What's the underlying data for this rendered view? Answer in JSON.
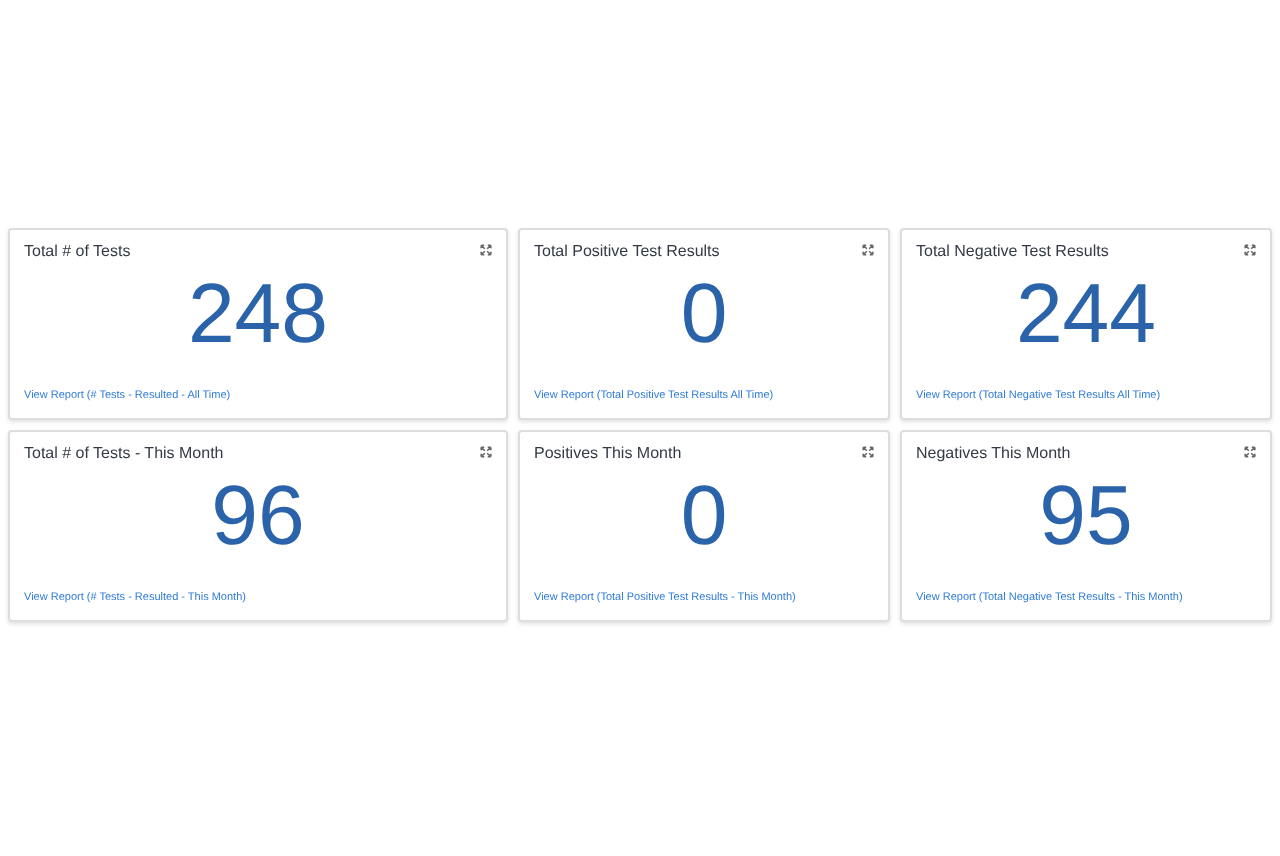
{
  "cards": [
    {
      "title": "Total # of Tests",
      "value": "248",
      "link": "View Report (# Tests - Resulted - All Time)"
    },
    {
      "title": "Total Positive Test Results",
      "value": "0",
      "link": "View Report (Total Positive Test Results All Time)"
    },
    {
      "title": "Total Negative Test Results",
      "value": "244",
      "link": "View Report (Total Negative Test Results All Time)"
    },
    {
      "title": "Total # of Tests - This Month",
      "value": "96",
      "link": "View Report (# Tests - Resulted - This Month)"
    },
    {
      "title": "Positives This Month",
      "value": "0",
      "link": "View Report (Total Positive Test Results - This Month)"
    },
    {
      "title": "Negatives This Month",
      "value": "95",
      "link": "View Report (Total Negative Test Results - This Month)"
    }
  ]
}
